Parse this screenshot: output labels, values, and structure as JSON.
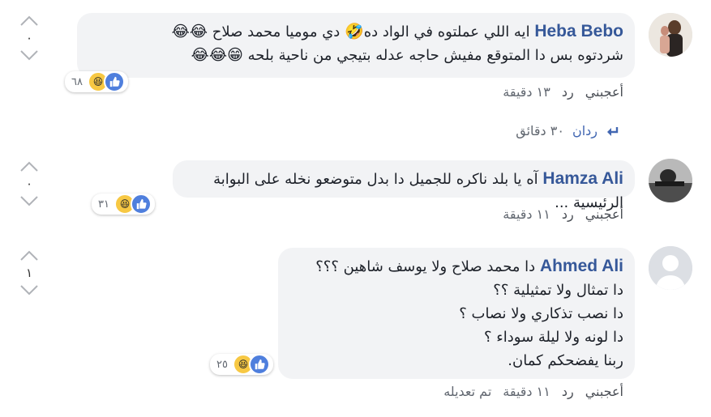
{
  "comments": [
    {
      "author": "Heba Bebo",
      "lines": [
        {
          "text": "ايه اللي عملتوه في الواد ده",
          "emoji": "🤣",
          "text2": " دي موميا محمد صلاح ",
          "emoji2": "😂😂"
        },
        {
          "text": "شردتوه بس دا المتوقع مفيش حاجه عدله بتيجي من ناحية بلحه ",
          "emoji": "😁😂😂"
        }
      ],
      "reaction_count": "٦٨",
      "like_label": "أعجبني",
      "reply_label": "رد",
      "time": "١٣ دقيقة",
      "vote_count": "٠"
    },
    {
      "author": "Hamza Ali",
      "lines": [
        {
          "text": "آه يا بلد ناكره للجميل دا بدل متوضعو نخله على البوابة الرئيسية ..."
        }
      ],
      "reaction_count": "٣١",
      "like_label": "أعجبني",
      "reply_label": "رد",
      "time": "١١ دقيقة",
      "vote_count": "٠"
    },
    {
      "author": "Ahmed Ali",
      "lines": [
        {
          "text": "دا محمد صلاح ولا يوسف شاهين ؟؟؟"
        },
        {
          "text": "دا تمثال ولا تمثيلية ؟؟"
        },
        {
          "text": "دا نصب تذكاري ولا نصاب ؟"
        },
        {
          "text": "دا لونه ولا ليلة سوداء ؟"
        },
        {
          "text": "ربنا يفضحكم كمان."
        }
      ],
      "reaction_count": "٢٥",
      "like_label": "أعجبني",
      "reply_label": "رد",
      "time": "١١ دقيقة",
      "edited_label": "تم تعديله",
      "vote_count": "١"
    }
  ],
  "replies": {
    "label": "ردان",
    "time": "٣٠ دقائق"
  },
  "colors": {
    "author": "#365899",
    "bubble": "#f2f3f5",
    "like_blue": "#4f7fdd",
    "haha_yellow": "#f7c843"
  },
  "icons": [
    "chevron-up-icon",
    "chevron-down-icon",
    "like-icon",
    "haha-icon",
    "reply-arrow-icon"
  ]
}
